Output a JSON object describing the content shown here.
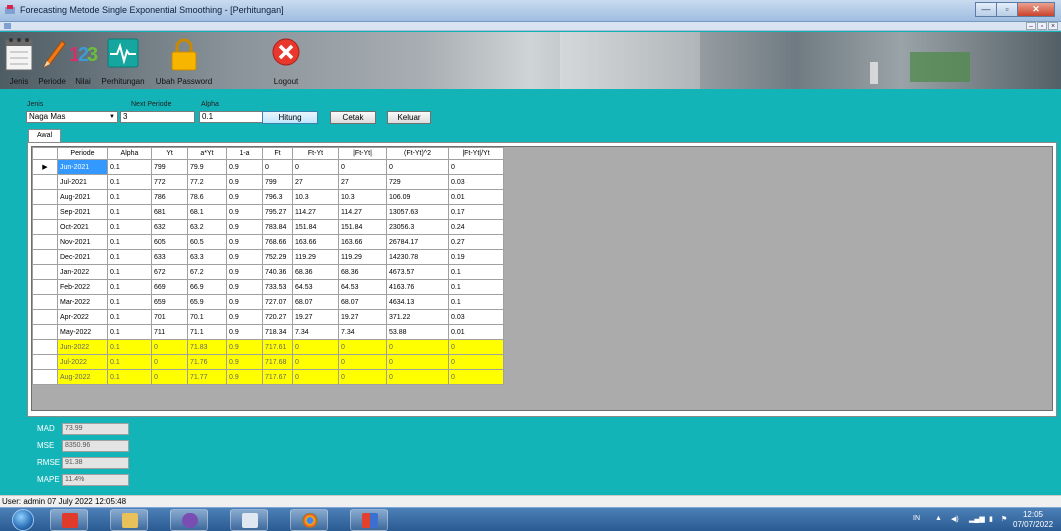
{
  "window": {
    "title": "Forecasting Metode Single Exponential Smoothing - [Perhitungan]",
    "controls": [
      "—",
      "▫",
      "✕"
    ],
    "mdi_controls": [
      "–",
      "▫",
      "×"
    ]
  },
  "toolbar": {
    "items": [
      {
        "label": "Jenis",
        "icon": "notepad-icon"
      },
      {
        "label": "Periode",
        "icon": "pencil-icon"
      },
      {
        "label": "Nilai",
        "icon": "numbers-icon"
      },
      {
        "label": "Perhitungan",
        "icon": "heartbeat-icon"
      },
      {
        "label": "Ubah Password",
        "icon": "lock-icon"
      },
      {
        "label": "Logout",
        "icon": "close-circle-icon"
      }
    ]
  },
  "form": {
    "jenis_label": "Jenis",
    "jenis_value": "Naga Mas",
    "next_periode_label": "Next Periode",
    "next_periode_value": "3",
    "alpha_label": "Alpha",
    "alpha_value": "0.1",
    "hitung_label": "Hitung",
    "cetak_label": "Cetak",
    "keluar_label": "Keluar"
  },
  "tabs": [
    {
      "label": "Awal"
    }
  ],
  "grid": {
    "columns": [
      "Periode",
      "Alpha",
      "Yt",
      "a*Yt",
      "1-a",
      "Ft",
      "Ft-Yt",
      "|Ft-Yt|",
      "(Ft-Yt)^2",
      "|Ft-Yt|/Yt"
    ],
    "current_row_marker": "▶",
    "rows": [
      [
        "Jun-2021",
        "0.1",
        "799",
        "79.9",
        "0.9",
        "0",
        "0",
        "0",
        "0",
        "0"
      ],
      [
        "Jul-2021",
        "0.1",
        "772",
        "77.2",
        "0.9",
        "799",
        "27",
        "27",
        "729",
        "0.03"
      ],
      [
        "Aug-2021",
        "0.1",
        "786",
        "78.6",
        "0.9",
        "796.3",
        "10.3",
        "10.3",
        "106.09",
        "0.01"
      ],
      [
        "Sep-2021",
        "0.1",
        "681",
        "68.1",
        "0.9",
        "795.27",
        "114.27",
        "114.27",
        "13057.63",
        "0.17"
      ],
      [
        "Oct-2021",
        "0.1",
        "632",
        "63.2",
        "0.9",
        "783.84",
        "151.84",
        "151.84",
        "23056.3",
        "0.24"
      ],
      [
        "Nov-2021",
        "0.1",
        "605",
        "60.5",
        "0.9",
        "768.66",
        "163.66",
        "163.66",
        "26784.17",
        "0.27"
      ],
      [
        "Dec-2021",
        "0.1",
        "633",
        "63.3",
        "0.9",
        "752.29",
        "119.29",
        "119.29",
        "14230.78",
        "0.19"
      ],
      [
        "Jan-2022",
        "0.1",
        "672",
        "67.2",
        "0.9",
        "740.36",
        "68.36",
        "68.36",
        "4673.57",
        "0.1"
      ],
      [
        "Feb-2022",
        "0.1",
        "669",
        "66.9",
        "0.9",
        "733.53",
        "64.53",
        "64.53",
        "4163.76",
        "0.1"
      ],
      [
        "Mar-2022",
        "0.1",
        "659",
        "65.9",
        "0.9",
        "727.07",
        "68.07",
        "68.07",
        "4634.13",
        "0.1"
      ],
      [
        "Apr-2022",
        "0.1",
        "701",
        "70.1",
        "0.9",
        "720.27",
        "19.27",
        "19.27",
        "371.22",
        "0.03"
      ],
      [
        "May-2022",
        "0.1",
        "711",
        "71.1",
        "0.9",
        "718.34",
        "7.34",
        "7.34",
        "53.88",
        "0.01"
      ],
      [
        "Jun-2022",
        "0.1",
        "0",
        "71.83",
        "0.9",
        "717.61",
        "0",
        "0",
        "0",
        "0"
      ],
      [
        "Jul-2022",
        "0.1",
        "0",
        "71.76",
        "0.9",
        "717.68",
        "0",
        "0",
        "0",
        "0"
      ],
      [
        "Aug-2022",
        "0.1",
        "0",
        "71.77",
        "0.9",
        "717.67",
        "0",
        "0",
        "0",
        "0"
      ]
    ],
    "forecast_highlight_color": "#ffff00",
    "selection_color": "#3399ff"
  },
  "stats": [
    {
      "label": "MAD",
      "value": "73.99"
    },
    {
      "label": "MSE",
      "value": "8350.96"
    },
    {
      "label": "RMSE",
      "value": "91.38"
    },
    {
      "label": "MAPE",
      "value": "11.4%"
    }
  ],
  "statusbar": {
    "text": "User: admin  07 July 2022 12:05:48"
  },
  "taskbar": {
    "apps": [
      "folder-app",
      "infinity-app",
      "notepad-app",
      "chrome-app",
      "forecast-app"
    ],
    "language": "IN",
    "time": "12:05",
    "date": "07/07/2022"
  },
  "colors": {
    "background": "#13b4b8",
    "label": "#ffffff"
  }
}
